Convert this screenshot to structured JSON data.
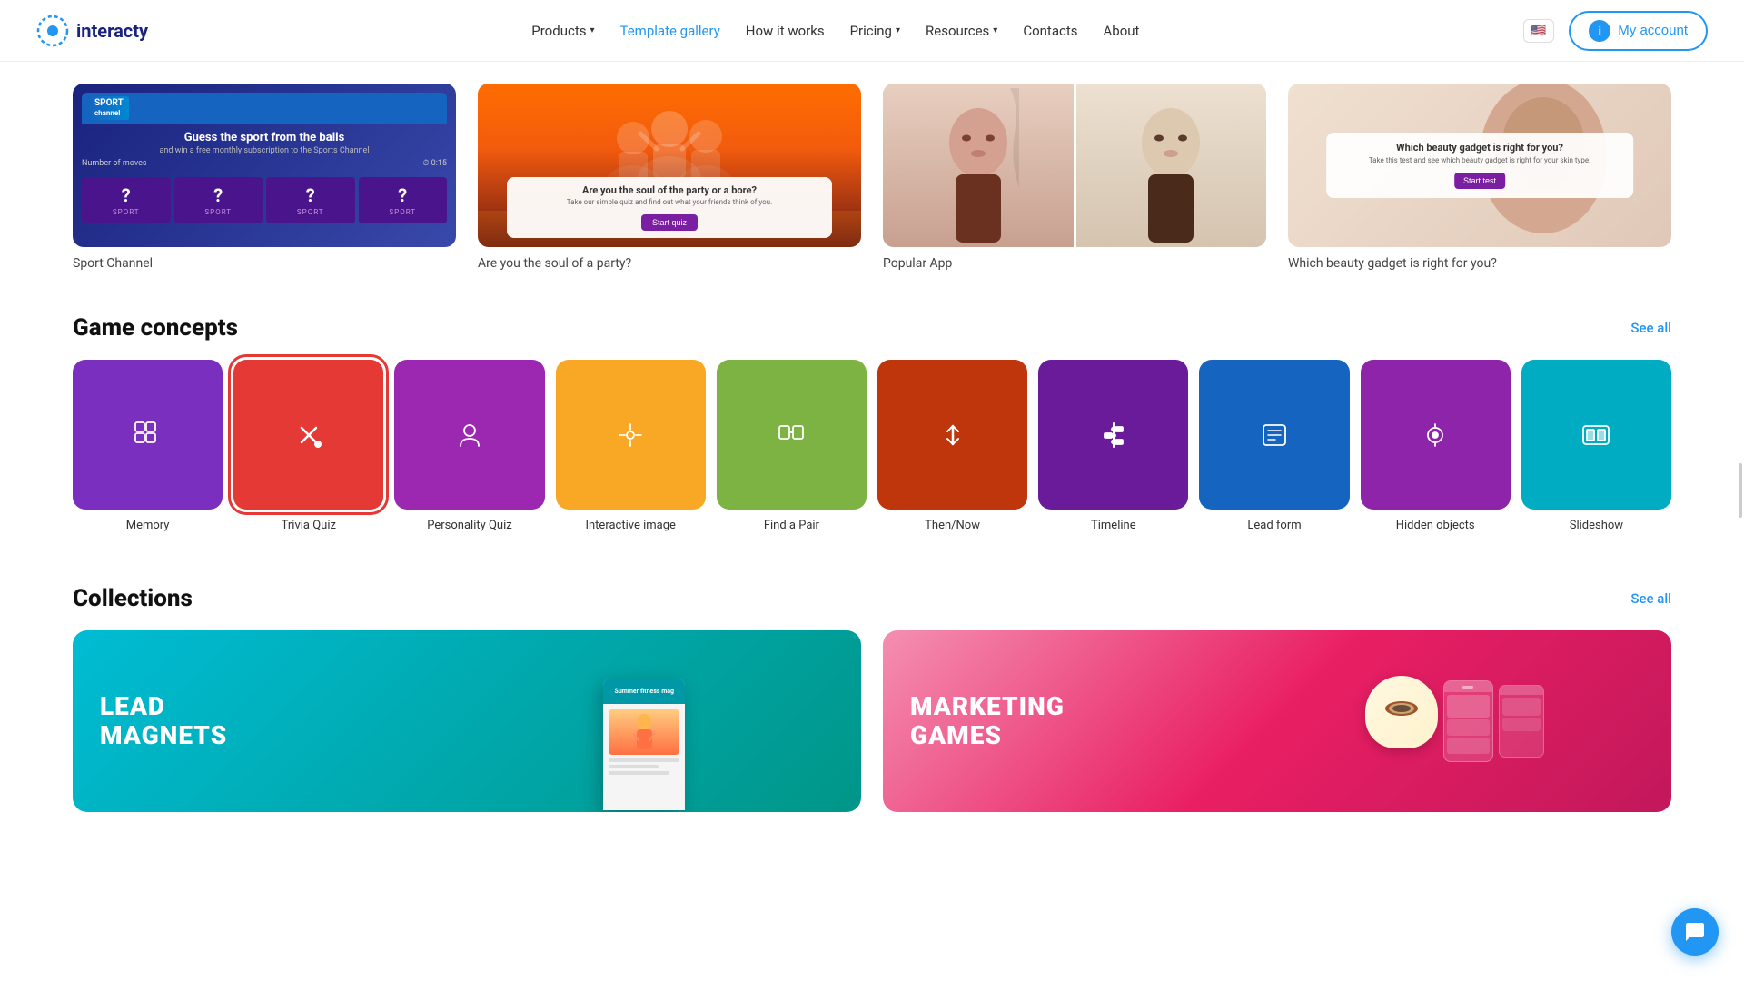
{
  "nav": {
    "logo_text": "interacty",
    "links": [
      {
        "label": "Products",
        "has_dropdown": true,
        "active": false
      },
      {
        "label": "Template gallery",
        "has_dropdown": false,
        "active": true
      },
      {
        "label": "How it works",
        "has_dropdown": false,
        "active": false
      },
      {
        "label": "Pricing",
        "has_dropdown": true,
        "active": false
      },
      {
        "label": "Resources",
        "has_dropdown": true,
        "active": false
      },
      {
        "label": "Contacts",
        "has_dropdown": false,
        "active": false
      },
      {
        "label": "About",
        "has_dropdown": false,
        "active": false
      }
    ],
    "my_account_label": "My account",
    "my_account_icon": "i"
  },
  "featured": [
    {
      "label": "Sport Channel",
      "type": "sport"
    },
    {
      "label": "Are you the soul of a party?",
      "type": "party"
    },
    {
      "label": "Popular App",
      "type": "popular"
    },
    {
      "label": "Which beauty gadget is right for you?",
      "type": "beauty"
    }
  ],
  "game_concepts": {
    "title": "Game concepts",
    "see_all": "See all",
    "items": [
      {
        "label": "Memory",
        "color": "#7b2fbe",
        "icon": "memory",
        "selected": false
      },
      {
        "label": "Trivia Quiz",
        "color": "#e53935",
        "icon": "trivia",
        "selected": true
      },
      {
        "label": "Personality Quiz",
        "color": "#9c27b0",
        "icon": "personality",
        "selected": false
      },
      {
        "label": "Interactive image",
        "color": "#f9a825",
        "icon": "interactive",
        "selected": false
      },
      {
        "label": "Find a Pair",
        "color": "#7cb342",
        "icon": "findpair",
        "selected": false
      },
      {
        "label": "Then/Now",
        "color": "#bf360c",
        "icon": "thennow",
        "selected": false
      },
      {
        "label": "Timeline",
        "color": "#6a1b9a",
        "icon": "timeline",
        "selected": false
      },
      {
        "label": "Lead form",
        "color": "#1565c0",
        "icon": "leadform",
        "selected": false
      },
      {
        "label": "Hidden objects",
        "color": "#8e24aa",
        "icon": "hidden",
        "selected": false
      },
      {
        "label": "Slideshow",
        "color": "#00acc1",
        "icon": "slideshow",
        "selected": false
      }
    ]
  },
  "collections": {
    "title": "Collections",
    "see_all": "See all",
    "items": [
      {
        "label": "LEAD\nMAGNETS",
        "type": "lead"
      },
      {
        "label": "MARKETING\nGAMES",
        "type": "marketing"
      }
    ]
  },
  "sport_card": {
    "channel": "SPORT",
    "channel_sub": "channel",
    "title": "Guess the sport from the balls",
    "subtitle": "and win a free monthly subscription to the Sports Channel",
    "moves_label": "Number of moves",
    "time": "0:15"
  },
  "party_card": {
    "question": "Are you the soul of the party or a bore?",
    "subtitle": "Take our simple quiz and find out what your friends think of you.",
    "button": "Start quiz"
  },
  "beauty_card": {
    "question": "Which beauty gadget is right for you?",
    "subtitle": "Take this test and see which beauty gadget is right for your skin type.",
    "button": "Start test"
  }
}
